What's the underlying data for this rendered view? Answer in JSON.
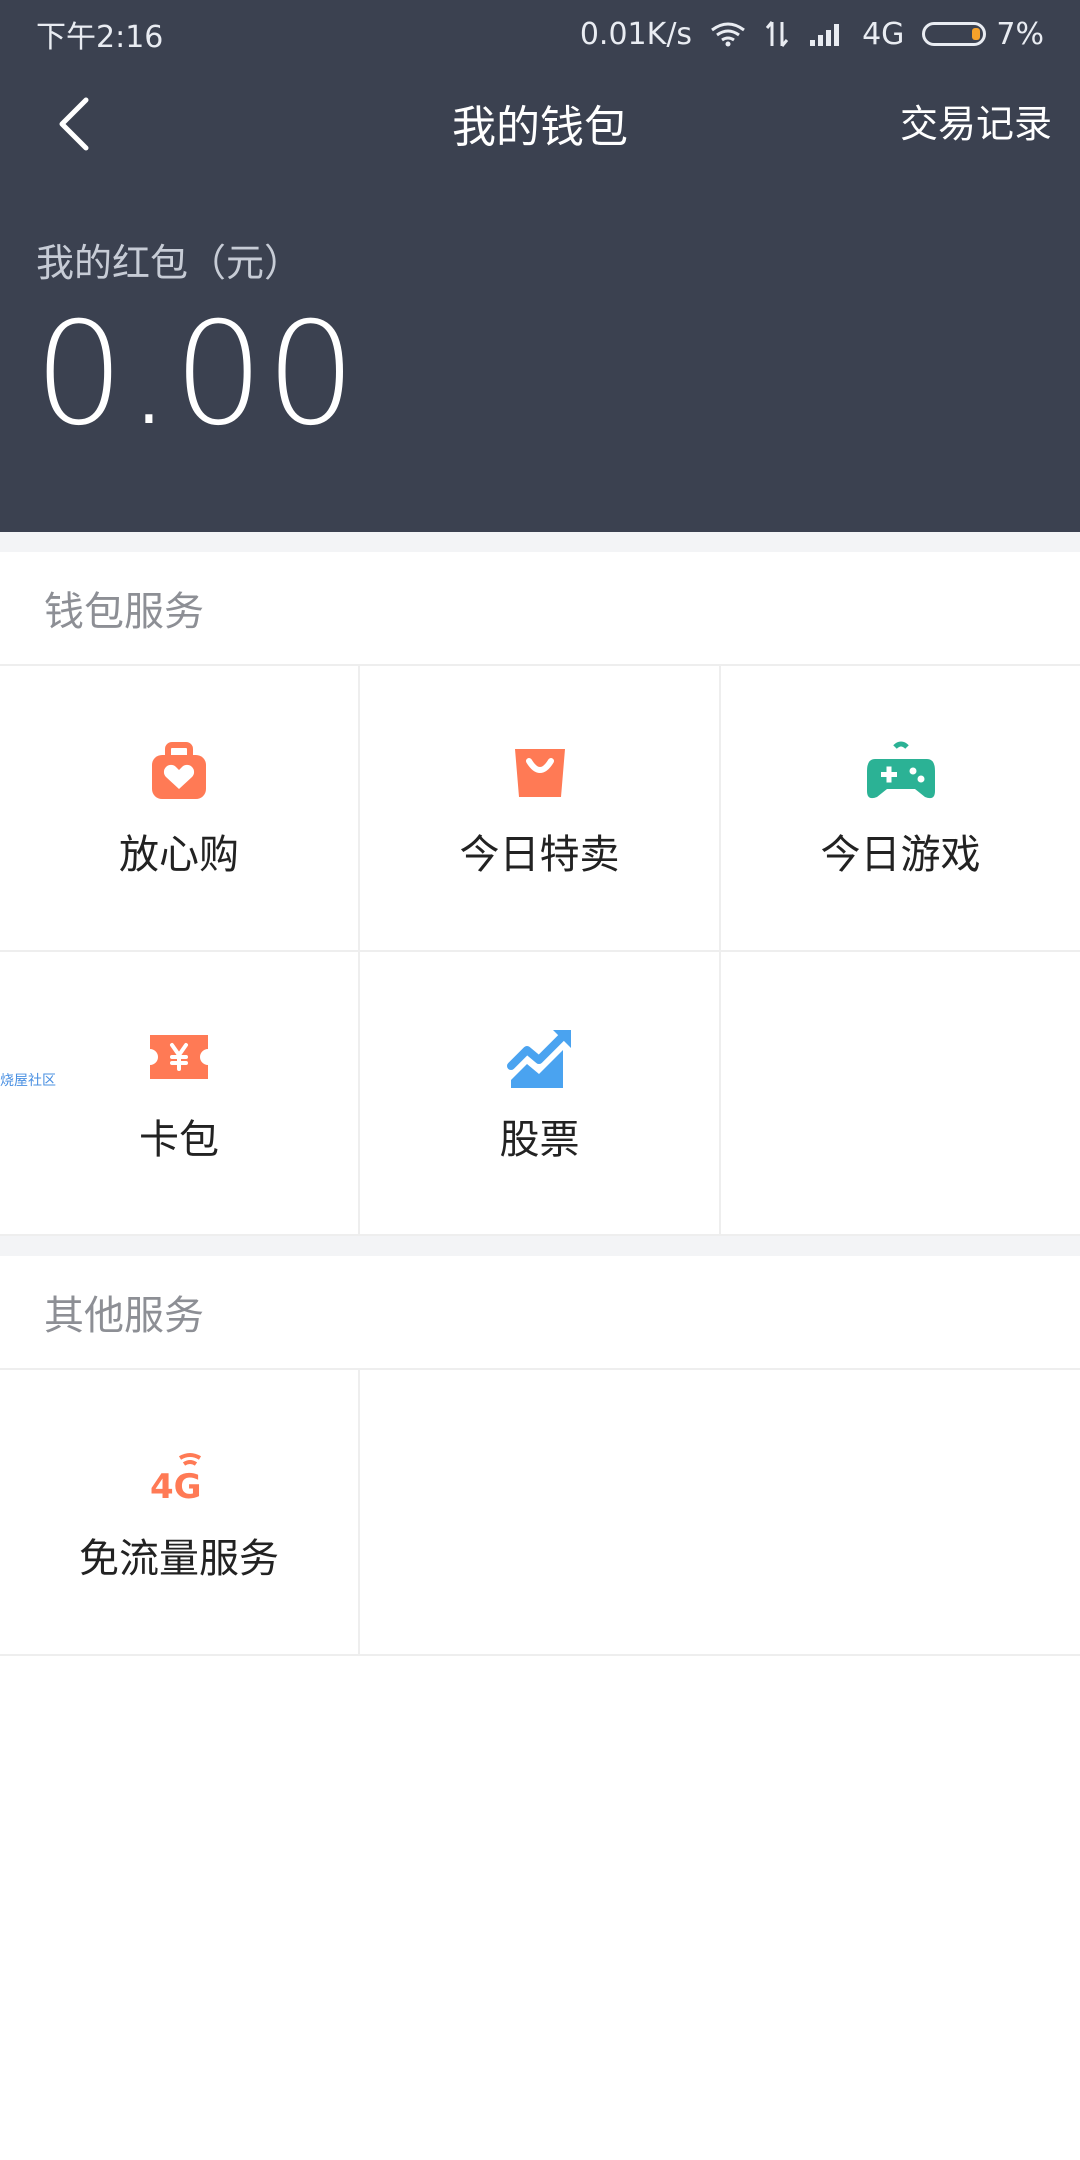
{
  "status_bar": {
    "time": "下午2:16",
    "speed": "0.01K/s",
    "network": "4G",
    "battery": "7%"
  },
  "header": {
    "title": "我的钱包",
    "transactions_label": "交易记录",
    "balance_label": "我的红包（元）",
    "balance_value": "0.00"
  },
  "wallet_services": {
    "title": "钱包服务",
    "items": [
      {
        "label": "放心购",
        "icon": "secure-shopping-icon"
      },
      {
        "label": "今日特卖",
        "icon": "shopping-bag-icon"
      },
      {
        "label": "今日游戏",
        "icon": "gamepad-icon"
      },
      {
        "label": "卡包",
        "icon": "card-ticket-icon"
      },
      {
        "label": "股票",
        "icon": "stocks-chart-icon"
      }
    ]
  },
  "other_services": {
    "title": "其他服务",
    "items": [
      {
        "label": "免流量服务",
        "icon": "4g-icon"
      }
    ]
  },
  "misc": {
    "tiny_side_text": "烧屋社区"
  },
  "colors": {
    "header_bg": "#3b4150",
    "accent_orange": "#ff7a55",
    "accent_green": "#2bb295",
    "accent_blue": "#4aa3f0",
    "section_gap": "#f3f4f6"
  }
}
